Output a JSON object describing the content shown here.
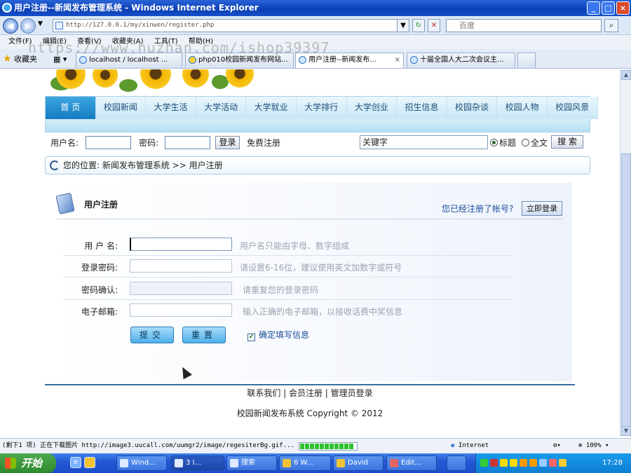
{
  "window": {
    "title": "用户注册--新闻发布管理系统 - Windows Internet Explorer",
    "controls": [
      "_",
      "□",
      "×"
    ]
  },
  "address_bar": {
    "url": "http://127.0.0.1/my/xinwen/register.php",
    "search_placeholder": "百度"
  },
  "menu": [
    "文件(F)",
    "编辑(E)",
    "查看(V)",
    "收藏夹(A)",
    "工具(T)",
    "帮助(H)"
  ],
  "favorites": {
    "label": "收藏夹",
    "tabs": [
      {
        "label": "localhost / localhost ...",
        "active": false
      },
      {
        "label": "php010校园新闻发布网站...",
        "active": false
      },
      {
        "label": "用户注册--新闻发布...",
        "active": true
      },
      {
        "label": "十届全国人大二次会议主...",
        "active": false
      }
    ]
  },
  "watermark": "https://www.huzhan.com/ishop39397",
  "site": {
    "nav": [
      "首  页",
      "校园新闻",
      "大学生活",
      "大学活动",
      "大学就业",
      "大学排行",
      "大学创业",
      "招生信息",
      "校园杂谈",
      "校园人物",
      "校园风景"
    ],
    "login": {
      "username_label": "用户名:",
      "password_label": "密码:",
      "login_button": "登录",
      "register_link": "免费注册"
    },
    "search": {
      "keyword_value": "关键字",
      "option_title": "标题",
      "option_fulltext": "全文",
      "button": "搜 索",
      "selected": "标题"
    },
    "breadcrumb": "您的位置: 新闻发布管理系统 >> 用户注册"
  },
  "register": {
    "title": "用户注册",
    "already_question": "您已经注册了帐号?",
    "login_now_button": "立即登录",
    "fields": [
      {
        "label": "用 户 名:",
        "value": "",
        "hint": "用户名只能由字母、数字组成"
      },
      {
        "label": "登录密码:",
        "value": "",
        "hint": "请设置6-16位，建议使用英文加数字或符号"
      },
      {
        "label": "密码确认:",
        "value": "",
        "hint": "请重复您的登录密码"
      },
      {
        "label": "电子邮箱:",
        "value": "",
        "hint": "输入正确的电子邮箱，以接收话费中奖信息"
      }
    ],
    "submit_button": "提交",
    "reset_button": "重置",
    "confirm_checkbox": "确定填写信息",
    "confirm_checked": true
  },
  "footer": {
    "links": "联系我们 | 会员注册 | 管理员登录",
    "copyright": "校园新闻发布系统 Copyright © 2012"
  },
  "status_bar": {
    "text": "(剩下1 项) 正在下载图片 http://image3.uucall.com/uumgr2/image/regesiterBg.gif...",
    "zone": "Internet",
    "zoom": "100%",
    "progress": 0.95
  },
  "taskbar": {
    "start": "开始",
    "items": [
      "Wind...",
      "3 I...",
      "搜索",
      "6 W...",
      "David",
      "Edit..."
    ],
    "clock": "17:28"
  }
}
